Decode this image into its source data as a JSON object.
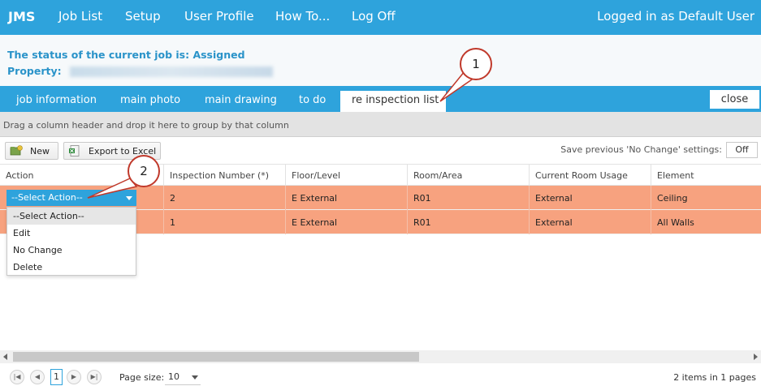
{
  "navbar": {
    "brand": "JMS",
    "links": [
      "Job List",
      "Setup",
      "User Profile",
      "How To...",
      "Log Off"
    ],
    "login_status": "Logged in as Default User"
  },
  "status": {
    "text": "The status of the current job is: Assigned",
    "property_label": "Property:"
  },
  "tabs": [
    "job information",
    "main photo",
    "main drawing",
    "to do",
    "re inspection list"
  ],
  "active_tab": "re inspection list",
  "close_label": "close",
  "group_panel_text": "Drag a column header and drop it here to group by that column",
  "toolbar": {
    "new_label": "New",
    "export_label": "Export to Excel",
    "save_label": "Save previous 'No Change' settings:",
    "toggle_value": "Off"
  },
  "grid": {
    "columns": [
      "Action",
      "Inspection Number (*)",
      "Floor/Level",
      "Room/Area",
      "Current Room Usage",
      "Element"
    ],
    "rows": [
      {
        "action": "--Select Action--",
        "inspection_number": "2",
        "floor": "E External",
        "room": "R01",
        "usage": "External",
        "element": "Ceiling"
      },
      {
        "action": "",
        "inspection_number": "1",
        "floor": "E External",
        "room": "R01",
        "usage": "External",
        "element": "All Walls"
      }
    ]
  },
  "dropdown": {
    "options": [
      "--Select Action--",
      "Edit",
      "No Change",
      "Delete"
    ]
  },
  "callouts": [
    "1",
    "2"
  ],
  "pager": {
    "current_page": "1",
    "page_size_label": "Page size:",
    "page_size": "10",
    "items_info": "2 items in 1 pages"
  },
  "colors": {
    "accent": "#2ea3dc",
    "row_highlight": "#f7a27f",
    "callout_border": "#c0392b"
  }
}
